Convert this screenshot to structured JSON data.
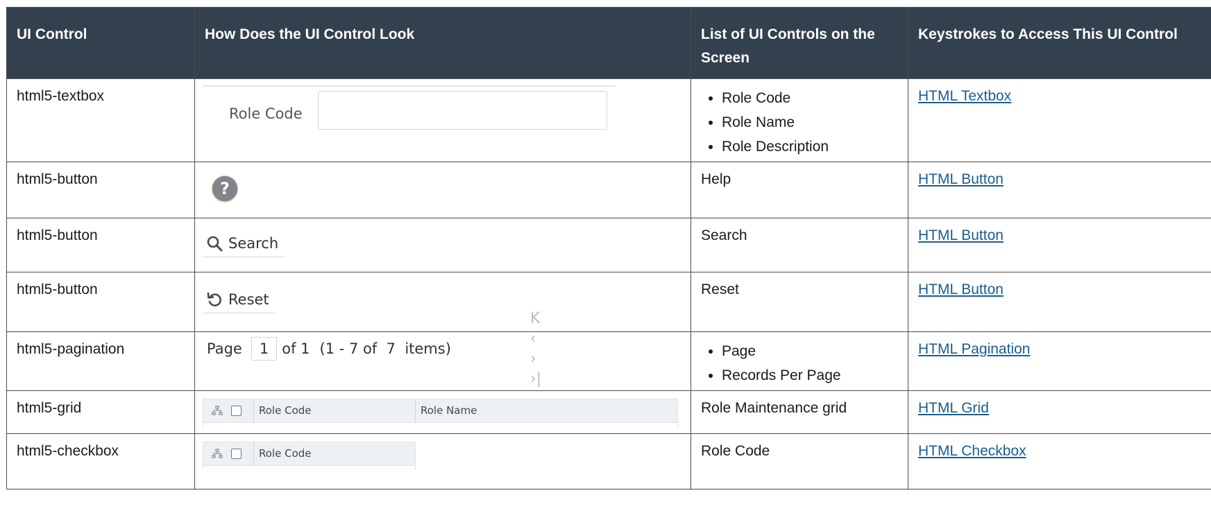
{
  "headers": {
    "ui_control": "UI Control",
    "look": "How Does the UI Control Look",
    "list": "List of UI Controls on the Screen",
    "keys": "Keystrokes to Access This UI Control"
  },
  "rows": [
    {
      "ui_control": "html5-textbox",
      "list": [
        "Role Code",
        "Role Name",
        "Role Description"
      ],
      "link": "HTML Textbox",
      "preview": {
        "label": "Role Code"
      }
    },
    {
      "ui_control": "html5-button",
      "list_text": "Help",
      "link": "HTML Button",
      "preview": {
        "icon": "help-icon",
        "glyph": "?"
      }
    },
    {
      "ui_control": "html5-button",
      "list_text": "Search",
      "link": "HTML Button",
      "preview": {
        "icon": "search-icon",
        "label": "Search"
      }
    },
    {
      "ui_control": "html5-button",
      "list_text": "Reset",
      "link": "HTML Button",
      "preview": {
        "icon": "reset-icon",
        "label": "Reset"
      }
    },
    {
      "ui_control": "html5-pagination",
      "list": [
        "Page",
        "Records Per Page"
      ],
      "link": "HTML Pagination",
      "preview": {
        "page_label": "Page",
        "page_value": "1",
        "of_text": "of 1",
        "range_text": "(1 - 7 of  7  items)",
        "nav_glyphs": [
          "K",
          "‹",
          "›",
          "›|"
        ]
      }
    },
    {
      "ui_control": "html5-grid",
      "list_text": "Role Maintenance grid",
      "link": "HTML Grid",
      "preview": {
        "col1": "Role Code",
        "col2": "Role Name",
        "icon": "hierarchy-icon"
      }
    },
    {
      "ui_control": "html5-checkbox",
      "list_text": "Role Code",
      "link": "HTML Checkbox",
      "preview": {
        "col1": "Role Code",
        "icon": "hierarchy-icon"
      }
    }
  ],
  "colors": {
    "header_bg": "#32414d",
    "link": "#1a5e8c"
  }
}
